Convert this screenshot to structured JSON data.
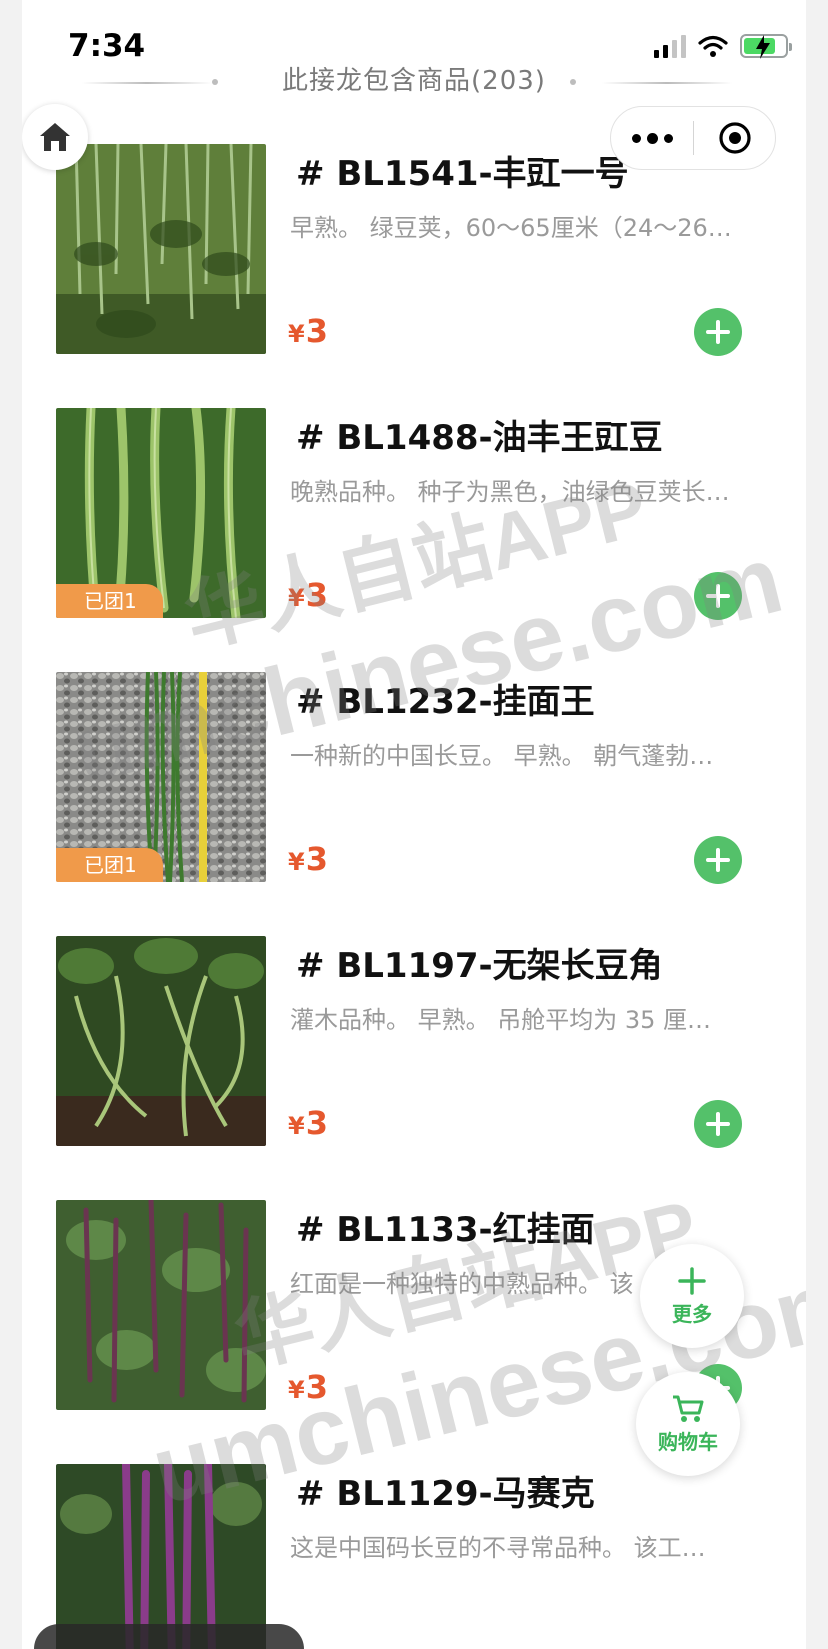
{
  "status_bar": {
    "time": "7:34"
  },
  "header": {
    "title": "此接龙包含商品(203)"
  },
  "products": [
    {
      "title": "# BL1541-丰豇一号",
      "desc": "早熟。 绿豆荚，60～65厘米（24～26…",
      "price_symbol": "¥",
      "price": "3",
      "badge": ""
    },
    {
      "title": "# BL1488-油丰王豇豆",
      "desc": "晚熟品种。 种子为黑色，油绿色豆荚长…",
      "price_symbol": "¥",
      "price": "3",
      "badge": "已团1"
    },
    {
      "title": "# BL1232-挂面王",
      "desc": "一种新的中国长豆。 早熟。 朝气蓬勃…",
      "price_symbol": "¥",
      "price": "3",
      "badge": "已团1"
    },
    {
      "title": "# BL1197-无架长豆角",
      "desc": "灌木品种。 早熟。 吊舱平均为 35 厘…",
      "price_symbol": "¥",
      "price": "3",
      "badge": ""
    },
    {
      "title": "# BL1133-红挂面",
      "desc": "红面是一种独特的中熟品种。 该",
      "price_symbol": "¥",
      "price": "3",
      "badge": ""
    },
    {
      "title": "# BL1129-马赛克",
      "desc": "这是中国码长豆的不寻常品种。 该工…",
      "price_symbol": "¥",
      "price": "",
      "badge": ""
    }
  ],
  "float_buttons": {
    "more_label": "更多",
    "cart_label": "购物车"
  },
  "watermark": {
    "line1": "华人自站APP",
    "line2": "umchinese.com"
  },
  "colors": {
    "accent_green": "#54c16a",
    "price_red": "#e5582e",
    "badge_orange": "#f09a4a"
  }
}
